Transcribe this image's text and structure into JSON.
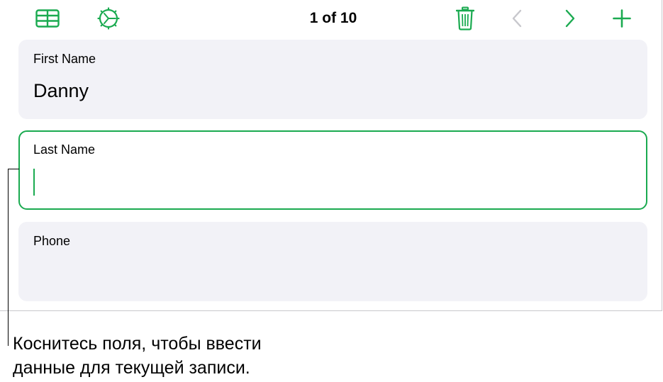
{
  "toolbar": {
    "record_counter": "1 of 10",
    "icons": {
      "left_1": "table-icon",
      "left_2": "format-gear-icon",
      "right_1": "trash-icon",
      "right_2": "chevron-left-icon",
      "right_3": "chevron-right-icon",
      "right_4": "plus-icon"
    }
  },
  "fields": [
    {
      "label": "First Name",
      "value": "Danny",
      "active": false
    },
    {
      "label": "Last Name",
      "value": "",
      "active": true
    },
    {
      "label": "Phone",
      "value": "",
      "active": false
    }
  ],
  "callout": {
    "line1": "Коснитесь поля, чтобы ввести",
    "line2": "данные для текущей записи."
  },
  "colors": {
    "accent": "#1aaa50",
    "field_background": "#f2f2f7",
    "disabled": "#c7c7cc"
  }
}
